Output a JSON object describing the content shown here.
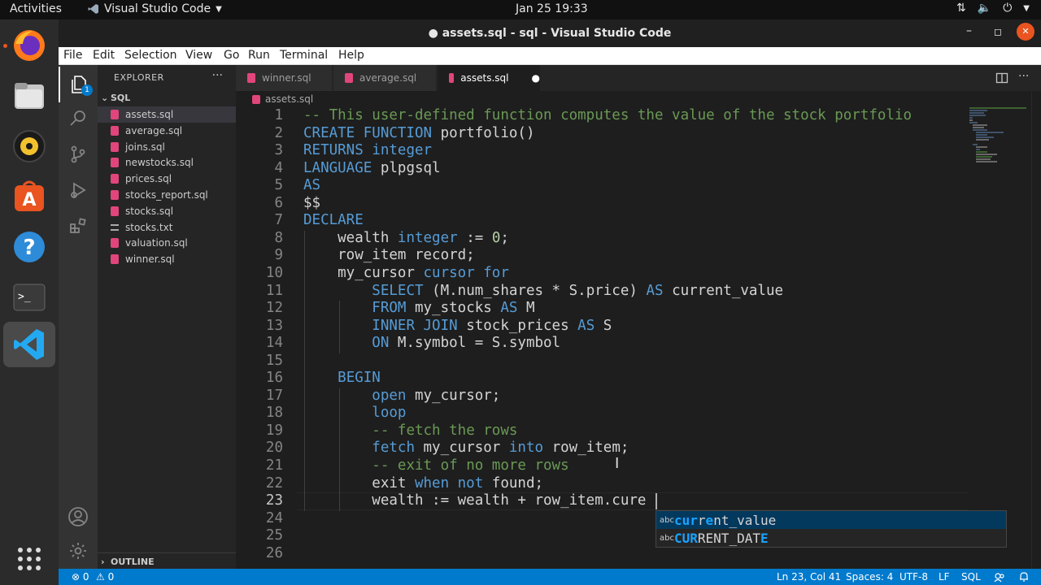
{
  "top_bar": {
    "activities": "Activities",
    "app_name": "Visual Studio Code",
    "clock": "Jan 25  19:33"
  },
  "dock": {
    "items": [
      "firefox-icon",
      "files-icon",
      "rhythmbox-icon",
      "software-icon",
      "help-icon",
      "terminal-icon",
      "vscode-icon",
      "apps-grid-icon"
    ]
  },
  "window": {
    "title": "● assets.sql - sql - Visual Studio Code",
    "minimize": "–",
    "maximize": "◻",
    "close": "✕"
  },
  "menu": {
    "file": "File",
    "edit": "Edit",
    "selection": "Selection",
    "view": "View",
    "go": "Go",
    "run": "Run",
    "terminal": "Terminal",
    "help": "Help"
  },
  "explorer": {
    "header": "EXPLORER",
    "more": "···",
    "folder": "SQL",
    "files": [
      {
        "name": "assets.sql",
        "type": "sql"
      },
      {
        "name": "average.sql",
        "type": "sql"
      },
      {
        "name": "joins.sql",
        "type": "sql"
      },
      {
        "name": "newstocks.sql",
        "type": "sql"
      },
      {
        "name": "prices.sql",
        "type": "sql"
      },
      {
        "name": "stocks_report.sql",
        "type": "sql"
      },
      {
        "name": "stocks.sql",
        "type": "sql"
      },
      {
        "name": "stocks.txt",
        "type": "txt"
      },
      {
        "name": "valuation.sql",
        "type": "sql"
      },
      {
        "name": "winner.sql",
        "type": "sql"
      }
    ],
    "outline": "OUTLINE",
    "badge": "1"
  },
  "tabs": [
    {
      "label": "winner.sql",
      "active": false
    },
    {
      "label": "average.sql",
      "active": false
    },
    {
      "label": "assets.sql",
      "active": true,
      "dirty": "●"
    }
  ],
  "breadcrumb": "assets.sql",
  "editor": {
    "current_line": 23,
    "lines": [
      [
        [
          "cm",
          "-- This user-defined function computes the value of the stock portfolio"
        ]
      ],
      [
        [
          "kw",
          "CREATE FUNCTION"
        ],
        [
          "tx",
          " portfolio()"
        ]
      ],
      [
        [
          "kw",
          "RETURNS"
        ],
        [
          "tx",
          " "
        ],
        [
          "kw",
          "integer"
        ]
      ],
      [
        [
          "kw",
          "LANGUAGE"
        ],
        [
          "tx",
          " plpgsql"
        ]
      ],
      [
        [
          "kw",
          "AS"
        ]
      ],
      [
        [
          "tx",
          "$$"
        ]
      ],
      [
        [
          "kw",
          "DECLARE"
        ]
      ],
      [
        [
          "tx",
          "    wealth "
        ],
        [
          "kw",
          "integer"
        ],
        [
          "tx",
          " := "
        ],
        [
          "nm",
          "0"
        ],
        [
          "tx",
          ";"
        ]
      ],
      [
        [
          "tx",
          "    row_item record;"
        ]
      ],
      [
        [
          "tx",
          "    my_cursor "
        ],
        [
          "kw",
          "cursor for"
        ]
      ],
      [
        [
          "tx",
          "        "
        ],
        [
          "kw",
          "SELECT"
        ],
        [
          "tx",
          " (M.num_shares * S.price) "
        ],
        [
          "kw",
          "AS"
        ],
        [
          "tx",
          " current_value"
        ]
      ],
      [
        [
          "tx",
          "        "
        ],
        [
          "kw",
          "FROM"
        ],
        [
          "tx",
          " my_stocks "
        ],
        [
          "kw",
          "AS"
        ],
        [
          "tx",
          " M"
        ]
      ],
      [
        [
          "tx",
          "        "
        ],
        [
          "kw",
          "INNER JOIN"
        ],
        [
          "tx",
          " stock_prices "
        ],
        [
          "kw",
          "AS"
        ],
        [
          "tx",
          " S"
        ]
      ],
      [
        [
          "tx",
          "        "
        ],
        [
          "kw",
          "ON"
        ],
        [
          "tx",
          " M.symbol = S.symbol"
        ]
      ],
      [
        [
          "tx",
          ""
        ]
      ],
      [
        [
          "tx",
          "    "
        ],
        [
          "kw",
          "BEGIN"
        ]
      ],
      [
        [
          "tx",
          "        "
        ],
        [
          "kw",
          "open"
        ],
        [
          "tx",
          " my_cursor;"
        ]
      ],
      [
        [
          "tx",
          "        "
        ],
        [
          "kw",
          "loop"
        ]
      ],
      [
        [
          "tx",
          "        "
        ],
        [
          "cm",
          "-- fetch the rows"
        ]
      ],
      [
        [
          "tx",
          "        "
        ],
        [
          "kw",
          "fetch"
        ],
        [
          "tx",
          " my_cursor "
        ],
        [
          "kw",
          "into"
        ],
        [
          "tx",
          " row_item;"
        ]
      ],
      [
        [
          "tx",
          "        "
        ],
        [
          "cm",
          "-- exit of no more rows"
        ]
      ],
      [
        [
          "tx",
          "        exit "
        ],
        [
          "kw",
          "when not"
        ],
        [
          "tx",
          " found;"
        ]
      ],
      [
        [
          "tx",
          "        wealth := wealth + row_item.cure"
        ]
      ],
      [
        [
          "tx",
          ""
        ]
      ],
      [
        [
          "tx",
          ""
        ]
      ],
      [
        [
          "tx",
          ""
        ]
      ]
    ]
  },
  "suggestions": [
    {
      "kind": "abc",
      "parts": [
        [
          "hl",
          "cur"
        ],
        [
          "tx",
          "r"
        ],
        [
          "hl",
          "e"
        ],
        [
          "tx",
          "nt_value"
        ]
      ],
      "selected": true
    },
    {
      "kind": "abc",
      "parts": [
        [
          "hl",
          "CUR"
        ],
        [
          "tx",
          "RENT_DAT"
        ],
        [
          "hl",
          "E"
        ]
      ],
      "selected": false
    }
  ],
  "status": {
    "errors": "⊗ 0",
    "warnings": "⚠ 0",
    "position": "Ln 23, Col 41",
    "spaces": "Spaces: 4",
    "encoding": "UTF-8",
    "eol": "LF",
    "language": "SQL"
  },
  "colors": {
    "accent": "#007acc",
    "sql_icon": "#e0457b",
    "keyword": "#569cd6",
    "comment": "#6a9955",
    "number": "#b5cea8"
  }
}
